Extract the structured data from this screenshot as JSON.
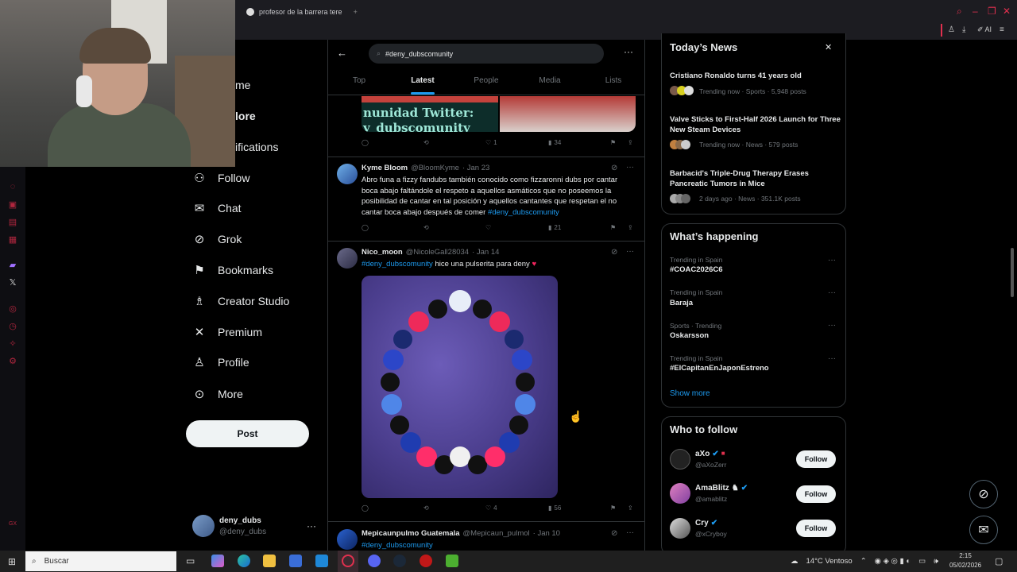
{
  "browser": {
    "tab_title": "profesor de la barrera tere",
    "new_tab": "+",
    "ai_label": "AI"
  },
  "nav": {
    "partial_home": "me",
    "partial_explore": "lore",
    "partial_notifications": "ifications",
    "follow": "Follow",
    "chat": "Chat",
    "grok": "Grok",
    "bookmarks": "Bookmarks",
    "creator_studio": "Creator Studio",
    "premium": "Premium",
    "profile": "Profile",
    "more": "More",
    "post_button": "Post",
    "account_name": "deny_dubs",
    "account_handle": "@deny_dubs"
  },
  "search": {
    "query": "#deny_dubscomunity"
  },
  "tabs": [
    "Top",
    "Latest",
    "People",
    "Media",
    "Lists"
  ],
  "tweets": [
    {
      "image_text_1": "nunidad Twitter:",
      "image_text_2": "y_dubscomunity",
      "likes": "1",
      "views": "34"
    },
    {
      "name": "Kyme Bloom",
      "handle": "@BloomKyme",
      "date": "· Jan 23",
      "text": "Abro funa a fizzy fandubs también conocido como fizzaronni dubs por cantar boca abajo faltándole el respeto a aquellos asmáticos que no poseemos la posibilidad de cantar en tal posición y aquellos cantantes que respetan el no cantar boca abajo después de comer",
      "hashtag": "#deny_dubscomunity",
      "views": "21"
    },
    {
      "name": "Nico_moon",
      "handle": "@NicoleGall28034",
      "date": "· Jan 14",
      "hashtag": "#deny_dubscomunity",
      "text": "hice una pulserita para deny",
      "likes": "4",
      "views": "56"
    },
    {
      "name": "Mepicaunpulmo Guatemala",
      "handle": "@Mepicaun_pulmol",
      "date": "· Jan 10",
      "hashtag": "#deny_dubscomunity"
    }
  ],
  "news": {
    "title": "Today’s News",
    "items": [
      {
        "headline": "Cristiano Ronaldo turns 41 years old",
        "meta": "Trending now · Sports · 5,948 posts"
      },
      {
        "headline": "Valve Sticks to First-Half 2026 Launch for Three New Steam Devices",
        "meta": "Trending now · News · 579 posts"
      },
      {
        "headline": "Barbacid's Triple-Drug Therapy Erases Pancreatic Tumors in Mice",
        "meta": "2 days ago · News · 351.1K posts"
      }
    ]
  },
  "happening": {
    "title": "What’s happening",
    "trends": [
      {
        "context": "Trending in Spain",
        "tag": "#COAC2026C6"
      },
      {
        "context": "Trending in Spain",
        "tag": "Baraja"
      },
      {
        "context": "Sports · Trending",
        "tag": "Oskarsson"
      },
      {
        "context": "Trending in Spain",
        "tag": "#ElCapitanEnJaponEstreno"
      }
    ],
    "show_more": "Show more"
  },
  "who_to_follow": {
    "title": "Who to follow",
    "users": [
      {
        "name": "aXo",
        "handle": "@aXoZerr",
        "button": "Follow"
      },
      {
        "name": "AmaBlitz",
        "handle": "@amablitz",
        "button": "Follow"
      },
      {
        "name": "Cry",
        "handle": "@xCryboy",
        "button": "Follow"
      }
    ]
  },
  "taskbar": {
    "search_placeholder": "Buscar",
    "weather": "14°C  Ventoso",
    "time": "2:15",
    "date": "05/02/2026"
  },
  "colors": {
    "accent": "#1d9bf0",
    "border": "#2f3336",
    "muted": "#71767b",
    "opera_red": "#e0304e"
  }
}
